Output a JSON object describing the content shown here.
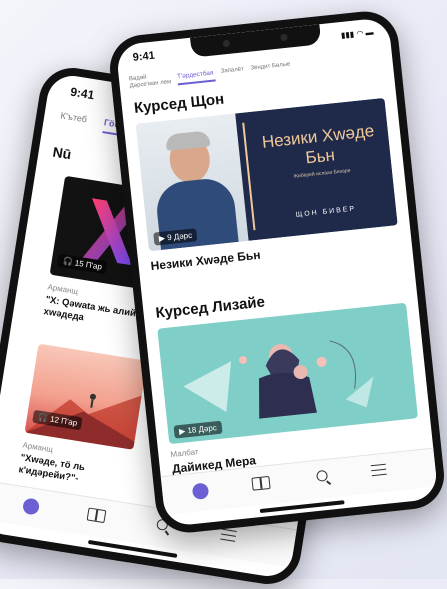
{
  "back_phone": {
    "status_time": "9:41",
    "tabs": [
      {
        "label": "К'ътеб"
      },
      {
        "label": "Гӧндарка"
      }
    ],
    "section_title": "Nū",
    "cards": [
      {
        "badge": "15 П'ар",
        "category": "Арманщ",
        "title": "\"X: Qəwata жь алийе хwәдеда"
      },
      {
        "badge": "12 П'ар",
        "category": "Арманщ",
        "title": "\"Хwәде, тӧ ль к'идәрейи?\"-"
      }
    ]
  },
  "front_phone": {
    "status_time": "9:41",
    "tabs": [
      {
        "label": "Вәдәй Дәрсе'ман лем"
      },
      {
        "label": "Т'әрдестбая"
      },
      {
        "label": "Запалёт"
      },
      {
        "label": "Зёндит Бөлые"
      }
    ],
    "sections": [
      {
        "title": "Курсед Щон",
        "book_title": "Незики Хwәде Бьн",
        "book_subtitle": "Жиберей ислахи Бихари",
        "author": "ЩОН БИВЕР",
        "badge": "9 Дәрс",
        "course_title": "Незики Хwәде Бьн"
      },
      {
        "title": "Курсед Лизайе",
        "badge": "18 Дәрс",
        "category": "Малбат",
        "course_title": "Дайикед Мера"
      }
    ]
  },
  "nav": {
    "icons": [
      "compass-icon",
      "book-icon",
      "search-icon",
      "menu-icon"
    ]
  },
  "colors": {
    "accent": "#6b5fd3",
    "book_cover": "#1f2a4b",
    "book_text": "#f0c89a",
    "teal_card": "#7fcfc8",
    "back_card_dark": "#121212"
  }
}
